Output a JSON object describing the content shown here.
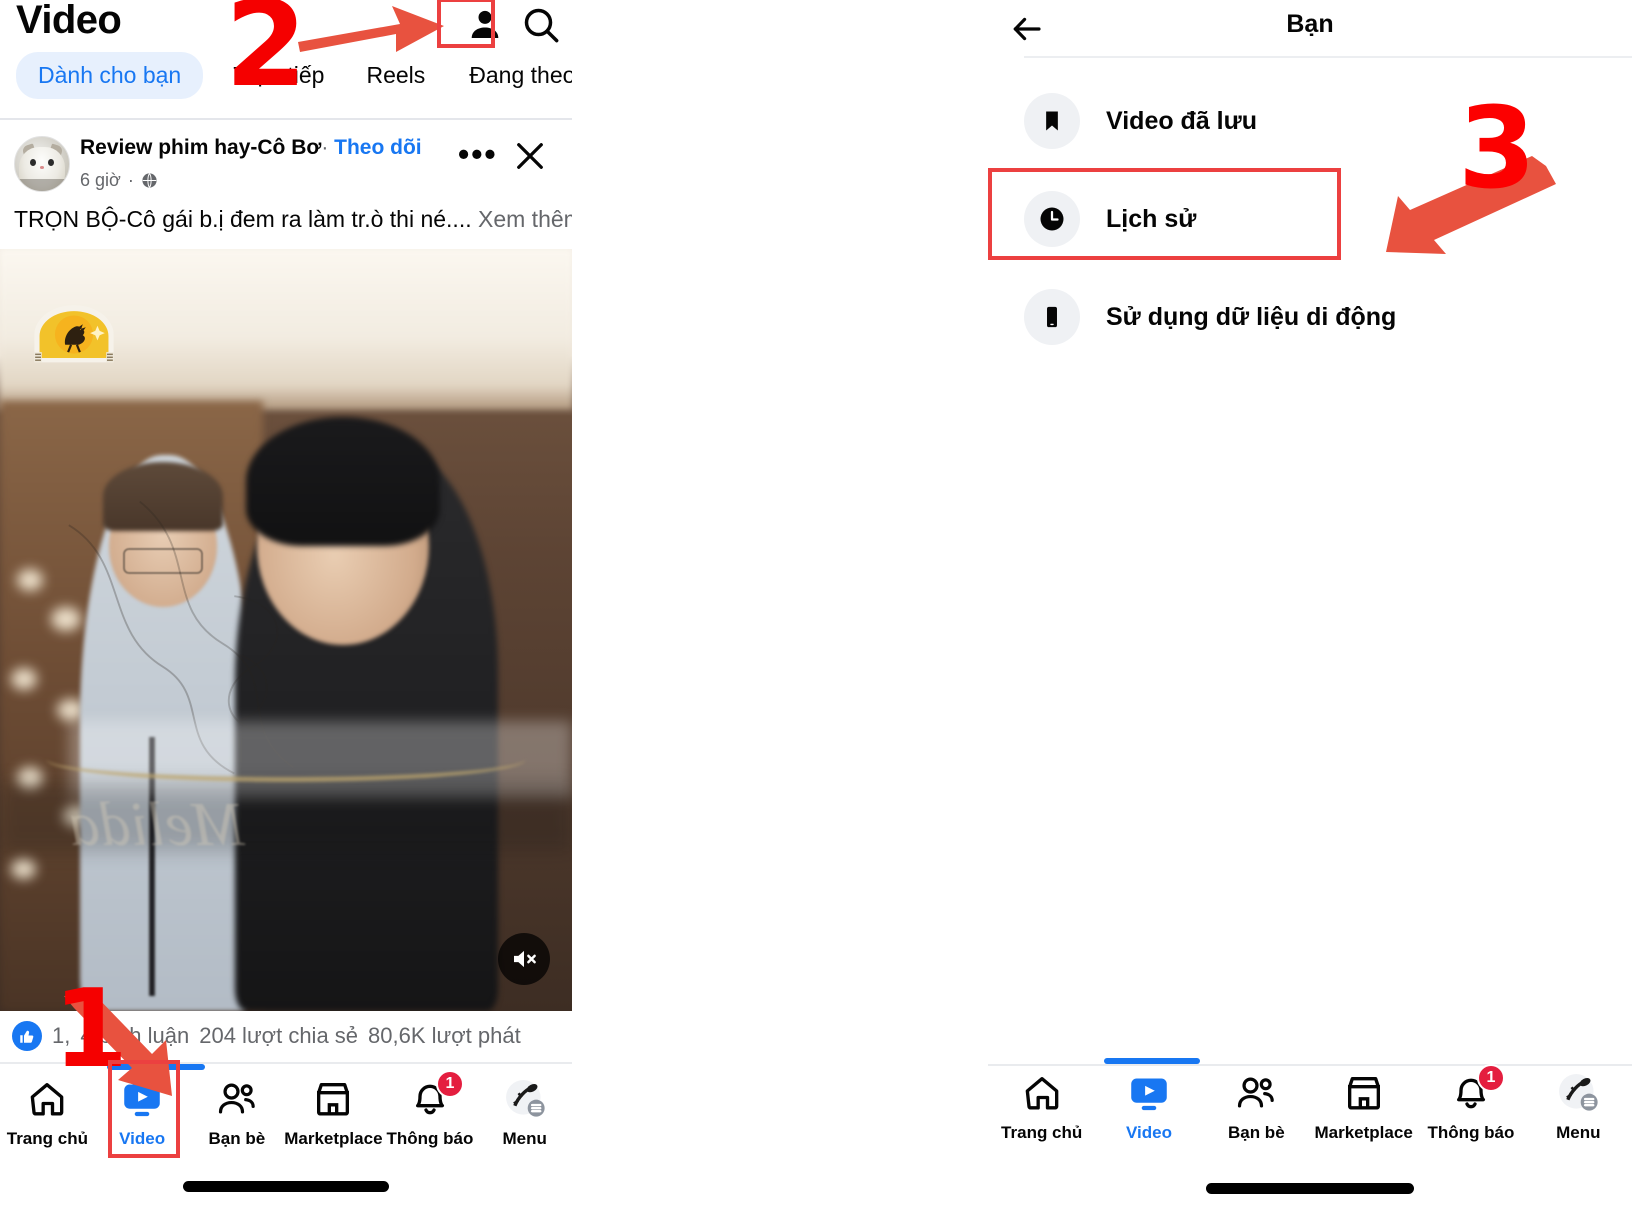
{
  "left_panel": {
    "header": {
      "title": "Video",
      "icons": [
        {
          "name": "person-icon",
          "label": "Bạn"
        },
        {
          "name": "search-icon",
          "label": "Tìm kiếm"
        }
      ],
      "tabs": [
        {
          "label": "Dành cho bạn",
          "active": true
        },
        {
          "label": "Trực tiếp",
          "active": false
        },
        {
          "label": "Reels",
          "active": false
        },
        {
          "label": "Đang theo dõi",
          "active": false
        }
      ]
    },
    "post": {
      "author": "Review phim hay-Cô Bơ",
      "separator": "·",
      "follow_label": "Theo dõi",
      "time": "6 giờ",
      "meta_separator": "·",
      "privacy_icon": "globe-icon",
      "menu_icon": "more-options-icon",
      "close_icon": "close-icon",
      "caption": "TRỌN BỘ-Cô gái b.ị đem ra làm tr.ò thi né....",
      "see_more_label": "Xem thêm",
      "video": {
        "mute_icon": "speaker-muted-icon",
        "channel_logo": "rooster-logo",
        "watermark": "Melida"
      }
    },
    "engagement": {
      "reaction_icon": "like-icon",
      "reaction_count": "1,",
      "comments": "4 bình luận",
      "shares": "204 lượt chia sẻ",
      "plays": "80,6K lượt phát"
    },
    "bottom_nav": [
      {
        "label": "Trang chủ",
        "icon": "home-icon",
        "active": false,
        "badge": null
      },
      {
        "label": "Video",
        "icon": "video-icon",
        "active": true,
        "badge": null
      },
      {
        "label": "Bạn bè",
        "icon": "friends-icon",
        "active": false,
        "badge": null
      },
      {
        "label": "Marketplace",
        "icon": "marketplace-icon",
        "active": false,
        "badge": null
      },
      {
        "label": "Thông báo",
        "icon": "bell-icon",
        "active": false,
        "badge": "1"
      },
      {
        "label": "Menu",
        "icon": "menu-avatar-icon",
        "active": false,
        "badge": null
      }
    ]
  },
  "right_panel": {
    "header": {
      "back_icon": "back-arrow-icon",
      "title": "Bạn"
    },
    "menu_items": [
      {
        "label": "Video đã lưu",
        "icon": "bookmark-icon",
        "highlighted": false
      },
      {
        "label": "Lịch sử",
        "icon": "clock-icon",
        "highlighted": true
      },
      {
        "label": "Sử dụng dữ liệu di động",
        "icon": "phone-icon",
        "highlighted": false
      }
    ],
    "bottom_nav": [
      {
        "label": "Trang chủ",
        "icon": "home-icon",
        "active": false,
        "badge": null
      },
      {
        "label": "Video",
        "icon": "video-icon",
        "active": true,
        "badge": null
      },
      {
        "label": "Bạn bè",
        "icon": "friends-icon",
        "active": false,
        "badge": null
      },
      {
        "label": "Marketplace",
        "icon": "marketplace-icon",
        "active": false,
        "badge": null
      },
      {
        "label": "Thông báo",
        "icon": "bell-icon",
        "active": false,
        "badge": "1"
      },
      {
        "label": "Menu",
        "icon": "menu-avatar-icon",
        "active": false,
        "badge": null
      }
    ]
  },
  "annotations": {
    "step_1": "1",
    "step_2": "2",
    "step_3": "3",
    "accent_red": "#ec4040",
    "number_red": "#f50000",
    "brand_blue": "#1877f2"
  }
}
